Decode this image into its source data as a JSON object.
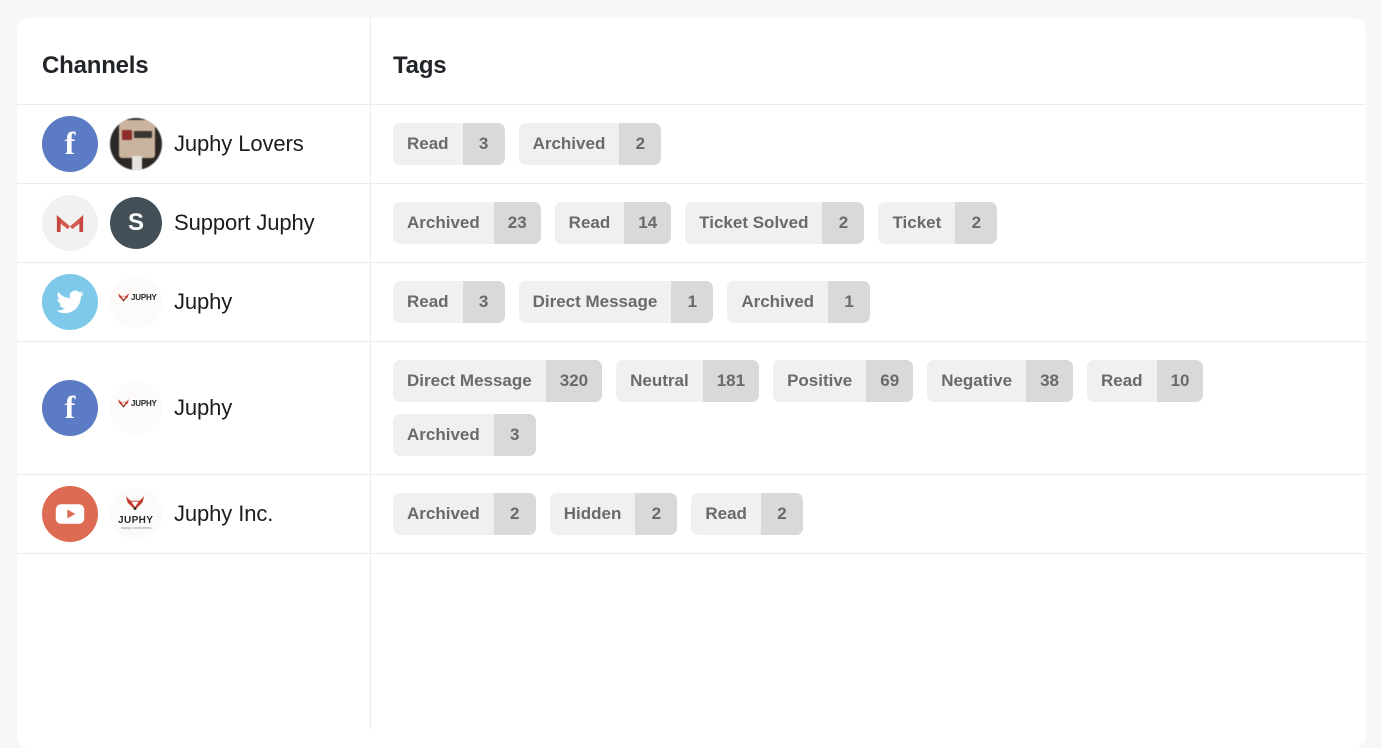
{
  "table": {
    "columns": {
      "channels": "Channels",
      "tags": "Tags"
    },
    "rows": [
      {
        "network": "facebook",
        "network_icon": "facebook-icon",
        "network_color": "#5b7bc4",
        "avatar_type": "photo",
        "avatar_name": "juphy-lovers-avatar",
        "name": "Juphy Lovers",
        "tags": [
          {
            "label": "Read",
            "count": "3"
          },
          {
            "label": "Archived",
            "count": "2"
          }
        ]
      },
      {
        "network": "gmail",
        "network_icon": "gmail-icon",
        "network_color": "#f1f1f1",
        "avatar_type": "initial",
        "avatar_initial": "S",
        "avatar_name": "support-juphy-avatar",
        "avatar_color": "#445057",
        "name": "Support Juphy",
        "tags": [
          {
            "label": "Archived",
            "count": "23"
          },
          {
            "label": "Read",
            "count": "14"
          },
          {
            "label": "Ticket Solved",
            "count": "2"
          },
          {
            "label": "Ticket",
            "count": "2"
          }
        ]
      },
      {
        "network": "twitter",
        "network_icon": "twitter-icon",
        "network_color": "#7ec8ea",
        "avatar_type": "juphy-logo",
        "avatar_name": "juphy-logo-avatar",
        "name": "Juphy",
        "tags": [
          {
            "label": "Read",
            "count": "3"
          },
          {
            "label": "Direct Message",
            "count": "1"
          },
          {
            "label": "Archived",
            "count": "1"
          }
        ]
      },
      {
        "network": "facebook",
        "network_icon": "facebook-icon",
        "network_color": "#5b7bc4",
        "avatar_type": "juphy-logo",
        "avatar_name": "juphy-logo-avatar",
        "name": "Juphy",
        "tags": [
          {
            "label": "Direct Message",
            "count": "320"
          },
          {
            "label": "Neutral",
            "count": "181"
          },
          {
            "label": "Positive",
            "count": "69"
          },
          {
            "label": "Negative",
            "count": "38"
          },
          {
            "label": "Read",
            "count": "10"
          },
          {
            "label": "Archived",
            "count": "3"
          }
        ]
      },
      {
        "network": "youtube",
        "network_icon": "youtube-icon",
        "network_color": "#dd6b54",
        "avatar_type": "juphy-logo-full",
        "avatar_name": "juphy-inc-avatar",
        "name": "Juphy Inc.",
        "tags": [
          {
            "label": "Archived",
            "count": "2"
          },
          {
            "label": "Hidden",
            "count": "2"
          },
          {
            "label": "Read",
            "count": "2"
          }
        ]
      }
    ]
  },
  "colors": {
    "card_background": "#ffffff",
    "page_background": "#f7f7f8",
    "divider": "#ececed",
    "tag_label_background": "#f0f0f1",
    "tag_count_background": "#d9d9da",
    "tag_text": "#6a6a6b",
    "heading_text": "#212529",
    "channel_text": "#1b1d1f"
  },
  "icon_glyphs": {
    "facebook": "f",
    "gmail": "gmail-envelope",
    "twitter": "twitter-bird",
    "youtube": "youtube-play"
  }
}
